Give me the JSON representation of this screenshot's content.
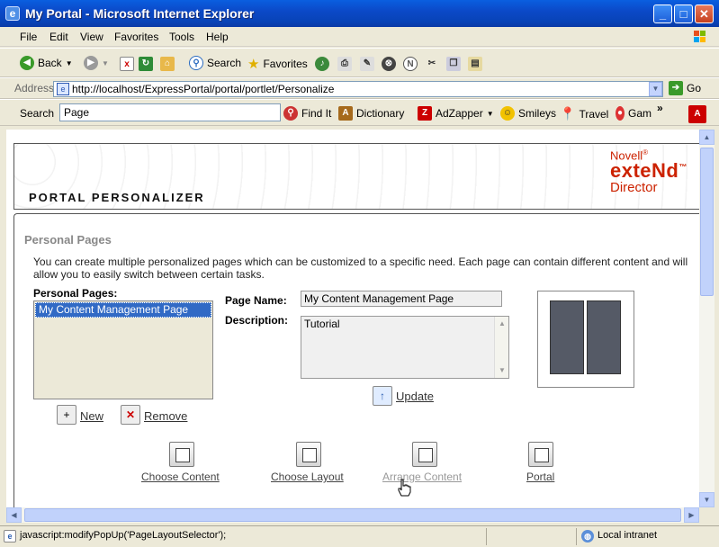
{
  "window": {
    "title": "My Portal - Microsoft Internet Explorer"
  },
  "menu": [
    "File",
    "Edit",
    "View",
    "Favorites",
    "Tools",
    "Help"
  ],
  "toolbar": {
    "back": "Back",
    "search": "Search",
    "favorites": "Favorites"
  },
  "address": {
    "label": "Address",
    "url": "http://localhost/ExpressPortal/portal/portlet/Personalize",
    "go": "Go"
  },
  "searchbar": {
    "label": "Search",
    "value": "Page",
    "items": [
      "Find It",
      "Dictionary",
      "AdZapper",
      "Smileys",
      "Travel",
      "Gam"
    ]
  },
  "portal": {
    "heading": "PORTAL PERSONALIZER",
    "brand": {
      "line1": "Novell",
      "reg": "®",
      "line2": "exteNd",
      "tm": "™",
      "line3": "Director"
    },
    "section_title": "Personal Pages",
    "description": "You can create multiple personalized pages which can be customized to a specific need. Each page can contain different content and will allow you to easily switch between certain tasks.",
    "list_label": "Personal Pages:",
    "pages": [
      "My Content Management Page"
    ],
    "page_name_label": "Page Name:",
    "page_name_value": "My Content Management Page",
    "description_label": "Description:",
    "description_value": "Tutorial",
    "update": "Update",
    "new": "New",
    "remove": "Remove",
    "nav": [
      "Choose Content",
      "Choose Layout",
      "Arrange Content",
      "Portal"
    ]
  },
  "status": {
    "text": "javascript:modifyPopUp('PageLayoutSelector');",
    "zone": "Local intranet"
  }
}
